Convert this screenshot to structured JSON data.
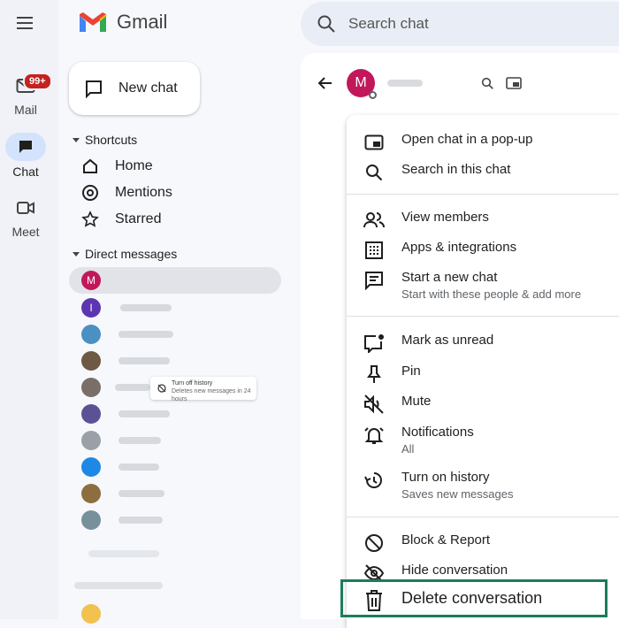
{
  "app": {
    "logo_text": "Gmail"
  },
  "rail": {
    "mail": {
      "label": "Mail",
      "badge": "99+"
    },
    "chat": {
      "label": "Chat"
    },
    "meet": {
      "label": "Meet"
    }
  },
  "sidebar": {
    "new_chat_label": "New chat",
    "shortcuts_heading": "Shortcuts",
    "shortcuts": [
      {
        "label": "Home",
        "icon": "home-icon"
      },
      {
        "label": "Mentions",
        "icon": "at-icon"
      },
      {
        "label": "Starred",
        "icon": "star-icon"
      }
    ],
    "dm_heading": "Direct messages",
    "dm_active_initial": "M",
    "dm_second_initial": "I",
    "tooltip": {
      "title": "Turn off history",
      "subtitle": "Deletes new messages in 24 hours"
    }
  },
  "search": {
    "placeholder": "Search chat"
  },
  "chat_header": {
    "avatar_initial": "M"
  },
  "menu": {
    "popup": "Open chat in a pop-up",
    "search": "Search in this chat",
    "members": "View members",
    "apps": "Apps & integrations",
    "new_chat": "Start a new chat",
    "new_chat_sub": "Start with these people & add more",
    "unread": "Mark as unread",
    "pin": "Pin",
    "mute": "Mute",
    "notifications": "Notifications",
    "notifications_sub": "All",
    "history": "Turn on history",
    "history_sub": "Saves new messages",
    "block": "Block & Report",
    "hide": "Hide conversation",
    "delete": "Delete conversation"
  },
  "colors": {
    "highlight": "#1b7d5a",
    "avatar_m": "#c2185b",
    "avatar_i": "#5e35b1"
  }
}
